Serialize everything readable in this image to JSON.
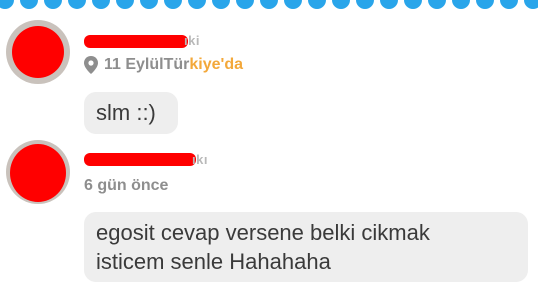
{
  "colors": {
    "accent": "#29a5ea",
    "redaction": "#ff0000",
    "meta_text": "#8e8e8e",
    "location_highlight": "#f3a83a",
    "bubble_bg": "#eeeeee",
    "bubble_text": "#3a3a3a"
  },
  "messages": [
    {
      "avatar": "redacted",
      "author_partial": "ıki",
      "meta_icon": "location-pin-icon",
      "meta_date": "11 Eylül ",
      "meta_location_plain": "Tür",
      "meta_location_highlight": "kiye'da",
      "text": "slm ::)"
    },
    {
      "avatar": "redacted",
      "author_partial": "ıkı",
      "meta_date": "6 gün önce",
      "text_lines": [
        "egosit cevap versene belki cikmak",
        "isticem senle Hahahaha"
      ]
    }
  ]
}
